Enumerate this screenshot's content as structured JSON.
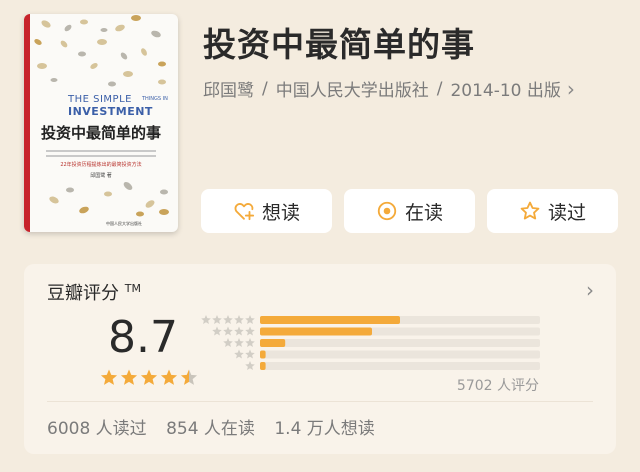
{
  "book": {
    "title": "投资中最简单的事",
    "author": "邱国鹭",
    "publisher": "中国人民大学出版社",
    "edition": "2014-10 出版"
  },
  "cover": {
    "en_line1": "THE SIMPLE",
    "en_line2": "INVESTMENT",
    "en_small": "THINGS IN",
    "cn_title": "投资中最简单的事",
    "subtitle": "22年投资历程提炼出的最简投资方法",
    "author_line": "邱国鹭 著",
    "publisher_line": "中国人民大学出版社"
  },
  "actions": {
    "want": "想读",
    "reading": "在读",
    "read": "读过"
  },
  "rating": {
    "title": "豆瓣评分",
    "tm": "TM",
    "score": "8.7",
    "stars": 4.5,
    "distribution": [
      {
        "stars": 5,
        "percent": 50
      },
      {
        "stars": 4,
        "percent": 40
      },
      {
        "stars": 3,
        "percent": 9
      },
      {
        "stars": 2,
        "percent": 2
      },
      {
        "stars": 1,
        "percent": 2
      }
    ],
    "count_text": "5702 人评分"
  },
  "stats": {
    "read": "6008 人读过",
    "reading": "854 人在读",
    "want": "1.4 万人想读"
  },
  "colors": {
    "accent": "#f4aa3a",
    "background": "#f4ecdf",
    "card": "#f9f3ea",
    "bar_track": "#ebe5dc",
    "text_secondary": "#7b7b7b"
  },
  "icons": {
    "want": "heart-plus-icon",
    "reading": "circle-dot-icon",
    "read": "star-outline-icon",
    "more": "chevron-right-icon"
  }
}
